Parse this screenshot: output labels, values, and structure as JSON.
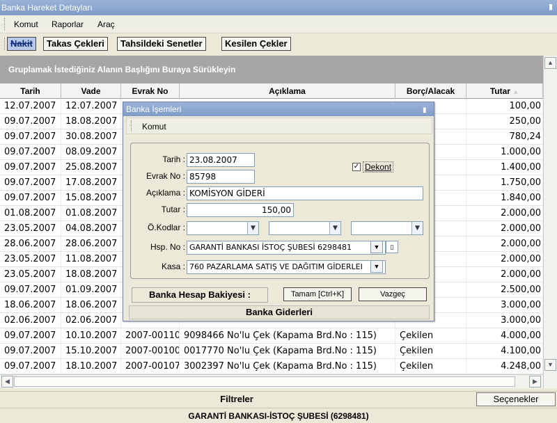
{
  "window": {
    "title": "Banka Hareket Detayları",
    "close_glyph": "▮"
  },
  "menu": {
    "items": [
      "Komut",
      "Raporlar",
      "Araç"
    ]
  },
  "tabs": [
    {
      "label": "Nakit",
      "active": true
    },
    {
      "label": "Takas Çekleri",
      "active": false
    },
    {
      "label": "Tahsildeki Senetler",
      "active": false
    },
    {
      "label": "Kesilen Çekler",
      "active": false
    }
  ],
  "group_hint": "Gruplamak İstediğiniz Alanın Başlığını Buraya Sürükleyin",
  "columns": [
    "Tarih",
    "Vade",
    "Evrak No",
    "Açıklama",
    "Borç/Alacak",
    "Tutar"
  ],
  "rows": [
    {
      "tarih": "12.07.2007",
      "vade": "12.07.2007",
      "evrak": "",
      "aciklama": "",
      "borc": "",
      "tutar": "100,00"
    },
    {
      "tarih": "09.07.2007",
      "vade": "18.08.2007",
      "evrak": "",
      "aciklama": "",
      "borc": "",
      "tutar": "250,00"
    },
    {
      "tarih": "09.07.2007",
      "vade": "30.08.2007",
      "evrak": "",
      "aciklama": "",
      "borc": "",
      "tutar": "780,24"
    },
    {
      "tarih": "09.07.2007",
      "vade": "08.09.2007",
      "evrak": "",
      "aciklama": "",
      "borc": "",
      "tutar": "1.000,00"
    },
    {
      "tarih": "09.07.2007",
      "vade": "25.08.2007",
      "evrak": "",
      "aciklama": "",
      "borc": "",
      "tutar": "1.400,00"
    },
    {
      "tarih": "09.07.2007",
      "vade": "17.08.2007",
      "evrak": "",
      "aciklama": "",
      "borc": "",
      "tutar": "1.750,00"
    },
    {
      "tarih": "09.07.2007",
      "vade": "15.08.2007",
      "evrak": "",
      "aciklama": "",
      "borc": "",
      "tutar": "1.840,00"
    },
    {
      "tarih": "01.08.2007",
      "vade": "01.08.2007",
      "evrak": "",
      "aciklama": "",
      "borc": "",
      "tutar": "2.000,00"
    },
    {
      "tarih": "23.05.2007",
      "vade": "04.08.2007",
      "evrak": "",
      "aciklama": "",
      "borc": "",
      "tutar": "2.000,00"
    },
    {
      "tarih": "28.06.2007",
      "vade": "28.06.2007",
      "evrak": "",
      "aciklama": "",
      "borc": "",
      "tutar": "2.000,00"
    },
    {
      "tarih": "23.05.2007",
      "vade": "11.08.2007",
      "evrak": "",
      "aciklama": "",
      "borc": "",
      "tutar": "2.000,00"
    },
    {
      "tarih": "23.05.2007",
      "vade": "18.08.2007",
      "evrak": "",
      "aciklama": "",
      "borc": "",
      "tutar": "2.000,00"
    },
    {
      "tarih": "09.07.2007",
      "vade": "01.09.2007",
      "evrak": "",
      "aciklama": "",
      "borc": "",
      "tutar": "2.500,00"
    },
    {
      "tarih": "18.06.2007",
      "vade": "18.06.2007",
      "evrak": "",
      "aciklama": "",
      "borc": "",
      "tutar": "3.000,00"
    },
    {
      "tarih": "02.06.2007",
      "vade": "02.06.2007",
      "evrak": "",
      "aciklama": "",
      "borc": "",
      "tutar": "3.000,00"
    },
    {
      "tarih": "09.07.2007",
      "vade": "10.10.2007",
      "evrak": "2007-00110",
      "aciklama": "9098466 No'lu Çek (Kapama Brd.No : 115)",
      "borc": "Çekilen",
      "tutar": "4.000,00"
    },
    {
      "tarih": "09.07.2007",
      "vade": "15.10.2007",
      "evrak": "2007-00100",
      "aciklama": "0017770 No'lu Çek (Kapama Brd.No : 115)",
      "borc": "Çekilen",
      "tutar": "4.100,00"
    },
    {
      "tarih": "09.07.2007",
      "vade": "18.10.2007",
      "evrak": "2007-00107",
      "aciklama": "3002397 No'lu Çek (Kapama Brd.No : 115)",
      "borc": "Çekilen",
      "tutar": "4.248,00"
    }
  ],
  "filter": {
    "label": "Filtreler",
    "options_label": "Seçenekler"
  },
  "status": "GARANTİ BANKASI-İSTOÇ ŞUBESİ (6298481)",
  "dialog": {
    "title": "Banka İşemleri",
    "menu_item": "Komut",
    "fields": {
      "tarih_label": "Tarih :",
      "tarih": "23.08.2007",
      "evrak_label": "Evrak No :",
      "evrak": "85798",
      "aciklama_label": "Açıklama :",
      "aciklama": "KOMİSYON GİDERİ",
      "tutar_label": "Tutar :",
      "tutar": "150,00",
      "okodlar_label": "Ö.Kodlar :",
      "hsp_label": "Hsp. No :",
      "hsp": "GARANTİ BANKASI İSTOÇ ŞUBESİ 6298481",
      "kasa_label": "Kasa :",
      "kasa": "760 PAZARLAMA SATIŞ VE DAĞITIM GİDERLEI"
    },
    "dekont_label": "Dekont",
    "dekont_checked": true,
    "balance_label": "Banka Hesap Bakiyesi :",
    "ok_label": "Tamam [Ctrl+K]",
    "cancel_label": "Vazgeç",
    "footer": "Banka Giderleri"
  }
}
